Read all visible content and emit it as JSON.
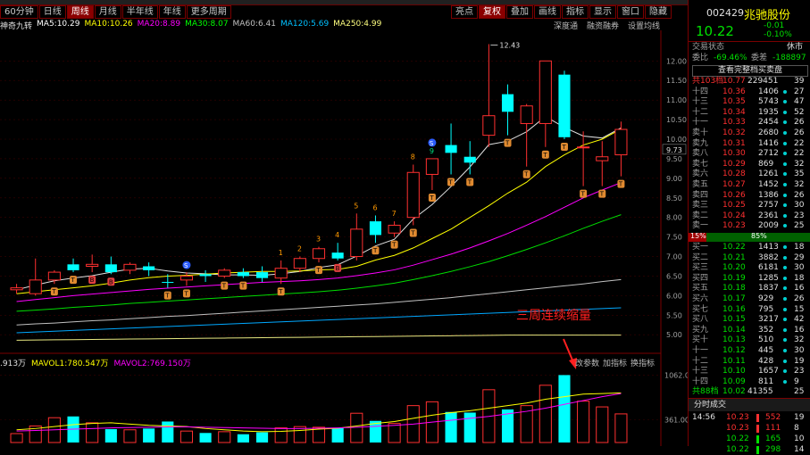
{
  "tabs": [
    {
      "label": "60分钟",
      "active": false
    },
    {
      "label": "日线",
      "active": false
    },
    {
      "label": "周线",
      "active": true
    },
    {
      "label": "月线",
      "active": false
    },
    {
      "label": "半年线",
      "active": false
    },
    {
      "label": "年线",
      "active": false
    },
    {
      "label": "更多周期",
      "active": false
    }
  ],
  "toolbar": [
    {
      "label": "亮点",
      "active": false
    },
    {
      "label": "复权",
      "active": true
    },
    {
      "label": "叠加",
      "active": false
    },
    {
      "label": "画线",
      "active": false
    },
    {
      "label": "指标",
      "active": false
    },
    {
      "label": "显示",
      "active": false
    },
    {
      "label": "窗口",
      "active": false
    },
    {
      "label": "隐藏",
      "active": false
    }
  ],
  "ma_bar": {
    "indicator": "神奇九转",
    "items": [
      {
        "text": "MA5:10.29",
        "color": "#ffffff"
      },
      {
        "text": "MA10:10.26",
        "color": "#ffff00"
      },
      {
        "text": "MA20:8.89",
        "color": "#ff00ff"
      },
      {
        "text": "MA30:8.07",
        "color": "#00ff00"
      },
      {
        "text": "MA60:6.41",
        "color": "#c0c0c0"
      },
      {
        "text": "MA120:5.69",
        "color": "#00c0ff"
      },
      {
        "text": "MA250:4.99",
        "color": "#ffff80"
      }
    ]
  },
  "top_ops": [
    "深度通",
    "融资融券",
    "设置均线"
  ],
  "vol_bar": {
    "items": [
      {
        "text": ".913万",
        "color": "#e0e0e0"
      },
      {
        "text": "MAVOL1:780.547万",
        "color": "#ffff00"
      },
      {
        "text": "MAVOL2:769.150万",
        "color": "#ff00ff"
      }
    ],
    "buttons": [
      "改参数",
      "加指标",
      "换指标"
    ]
  },
  "annotation": "三周连续缩量",
  "chart_data": {
    "type": "candlestick",
    "y_ticks": [
      5.0,
      5.5,
      6.0,
      6.5,
      7.0,
      7.5,
      8.0,
      8.5,
      9.0,
      9.5,
      10.0,
      10.5,
      11.0,
      11.5,
      12.0
    ],
    "ylim": [
      4.8,
      12.6
    ],
    "vol_ticks": [
      "1062.00",
      "361.00"
    ],
    "current_price_label": "9.73",
    "high_label": "12.43",
    "candles": [
      {
        "o": 6.2,
        "h": 6.3,
        "l": 6.05,
        "c": 6.15,
        "up": true,
        "vol": 140
      },
      {
        "o": 6.05,
        "h": 6.95,
        "l": 6.0,
        "c": 6.4,
        "up": true,
        "vol": 260
      },
      {
        "o": 6.4,
        "h": 6.65,
        "l": 6.3,
        "c": 6.6,
        "up": true,
        "vol": 390
      },
      {
        "o": 6.8,
        "h": 6.95,
        "l": 6.6,
        "c": 6.65,
        "up": false,
        "vol": 410
      },
      {
        "o": 6.8,
        "h": 7.05,
        "l": 6.6,
        "c": 6.75,
        "up": true,
        "vol": 310
      },
      {
        "o": 6.8,
        "h": 7.0,
        "l": 6.55,
        "c": 6.6,
        "up": false,
        "vol": 210
      },
      {
        "o": 6.65,
        "h": 6.85,
        "l": 6.55,
        "c": 6.8,
        "up": true,
        "vol": 200
      },
      {
        "o": 6.75,
        "h": 6.85,
        "l": 6.5,
        "c": 6.65,
        "up": false,
        "vol": 220
      },
      {
        "o": 6.35,
        "h": 6.55,
        "l": 6.2,
        "c": 6.35,
        "up": false,
        "vol": 330
      },
      {
        "o": 6.4,
        "h": 6.6,
        "l": 6.25,
        "c": 6.5,
        "up": true,
        "vol": 180
      },
      {
        "o": 6.55,
        "h": 6.65,
        "l": 6.35,
        "c": 6.5,
        "up": false,
        "vol": 150
      },
      {
        "o": 6.5,
        "h": 6.7,
        "l": 6.45,
        "c": 6.65,
        "up": true,
        "vol": 170
      },
      {
        "o": 6.6,
        "h": 6.7,
        "l": 6.45,
        "c": 6.5,
        "up": false,
        "vol": 130
      },
      {
        "o": 6.6,
        "h": 6.75,
        "l": 6.35,
        "c": 6.45,
        "up": false,
        "vol": 160
      },
      {
        "o": 6.45,
        "h": 6.9,
        "l": 6.3,
        "c": 6.7,
        "up": true,
        "vol": 230
      },
      {
        "o": 6.7,
        "h": 7.0,
        "l": 6.6,
        "c": 6.95,
        "up": true,
        "vol": 250
      },
      {
        "o": 6.95,
        "h": 7.25,
        "l": 6.85,
        "c": 7.2,
        "up": true,
        "vol": 240
      },
      {
        "o": 7.1,
        "h": 7.35,
        "l": 6.9,
        "c": 6.95,
        "up": false,
        "vol": 230
      },
      {
        "o": 7.0,
        "h": 8.1,
        "l": 6.9,
        "c": 7.7,
        "up": true,
        "vol": 460
      },
      {
        "o": 7.9,
        "h": 8.05,
        "l": 7.35,
        "c": 7.55,
        "up": false,
        "vol": 340
      },
      {
        "o": 7.6,
        "h": 7.9,
        "l": 7.5,
        "c": 7.8,
        "up": true,
        "vol": 300
      },
      {
        "o": 8.0,
        "h": 9.35,
        "l": 7.8,
        "c": 9.15,
        "up": true,
        "vol": 580
      },
      {
        "o": 9.1,
        "h": 9.5,
        "l": 8.7,
        "c": 9.5,
        "up": true,
        "vol": 640
      },
      {
        "o": 9.85,
        "h": 10.4,
        "l": 9.1,
        "c": 9.65,
        "up": false,
        "vol": 480
      },
      {
        "o": 9.55,
        "h": 9.95,
        "l": 9.1,
        "c": 9.4,
        "up": false,
        "vol": 470
      },
      {
        "o": 10.1,
        "h": 12.43,
        "l": 9.8,
        "c": 10.6,
        "up": true,
        "vol": 830
      },
      {
        "o": 11.15,
        "h": 11.4,
        "l": 10.1,
        "c": 10.7,
        "up": false,
        "vol": 520
      },
      {
        "o": 10.4,
        "h": 10.9,
        "l": 9.3,
        "c": 10.85,
        "up": true,
        "vol": 580
      },
      {
        "o": 10.4,
        "h": 12.0,
        "l": 9.8,
        "c": 12.0,
        "up": true,
        "vol": 900
      },
      {
        "o": 11.65,
        "h": 11.75,
        "l": 10.0,
        "c": 10.05,
        "up": false,
        "vol": 1060
      },
      {
        "o": 9.8,
        "h": 10.2,
        "l": 8.8,
        "c": 9.8,
        "up": true,
        "vol": 650
      },
      {
        "o": 9.55,
        "h": 9.95,
        "l": 8.8,
        "c": 9.45,
        "up": true,
        "vol": 560
      },
      {
        "o": 9.6,
        "h": 10.45,
        "l": 9.05,
        "c": 10.25,
        "up": true,
        "vol": 450
      }
    ],
    "ma": [
      {
        "name": "MA5",
        "color": "#e0e0e0",
        "values": [
          6.15,
          6.27,
          6.38,
          6.45,
          6.51,
          6.6,
          6.68,
          6.7,
          6.63,
          6.58,
          6.56,
          6.53,
          6.53,
          6.52,
          6.56,
          6.62,
          6.72,
          6.79,
          7.01,
          7.27,
          7.44,
          7.96,
          8.33,
          8.79,
          9.29,
          9.86,
          9.95,
          10.19,
          10.58,
          10.3,
          10.08,
          10.03,
          10.29
        ]
      },
      {
        "name": "MA10",
        "color": "#ffff00",
        "values": [
          6.05,
          6.1,
          6.15,
          6.2,
          6.25,
          6.32,
          6.4,
          6.46,
          6.5,
          6.52,
          6.55,
          6.58,
          6.6,
          6.62,
          6.62,
          6.63,
          6.66,
          6.67,
          6.75,
          6.91,
          7.03,
          7.22,
          7.46,
          7.7,
          8.0,
          8.3,
          8.62,
          8.9,
          9.3,
          9.6,
          9.85,
          10.0,
          10.26
        ]
      },
      {
        "name": "MA20",
        "color": "#ff00ff",
        "values": [
          5.85,
          5.9,
          5.95,
          6.0,
          6.04,
          6.08,
          6.12,
          6.16,
          6.19,
          6.22,
          6.25,
          6.28,
          6.31,
          6.34,
          6.36,
          6.38,
          6.41,
          6.45,
          6.51,
          6.58,
          6.66,
          6.78,
          6.92,
          7.06,
          7.22,
          7.4,
          7.59,
          7.8,
          8.02,
          8.26,
          8.5,
          8.7,
          8.89
        ]
      },
      {
        "name": "MA30",
        "color": "#00dd00",
        "values": [
          5.6,
          5.63,
          5.66,
          5.7,
          5.73,
          5.76,
          5.8,
          5.83,
          5.86,
          5.89,
          5.92,
          5.95,
          5.98,
          6.01,
          6.04,
          6.07,
          6.1,
          6.14,
          6.19,
          6.25,
          6.32,
          6.41,
          6.51,
          6.62,
          6.74,
          6.87,
          7.02,
          7.18,
          7.35,
          7.53,
          7.72,
          7.9,
          8.07
        ]
      },
      {
        "name": "MA60",
        "color": "#c0c0c0",
        "values": [
          5.25,
          5.28,
          5.3,
          5.33,
          5.36,
          5.38,
          5.41,
          5.44,
          5.47,
          5.49,
          5.52,
          5.55,
          5.58,
          5.61,
          5.64,
          5.67,
          5.7,
          5.73,
          5.76,
          5.79,
          5.83,
          5.87,
          5.91,
          5.95,
          6.0,
          6.05,
          6.1,
          6.15,
          6.2,
          6.25,
          6.3,
          6.36,
          6.41
        ]
      },
      {
        "name": "MA120",
        "color": "#00a8ff",
        "values": [
          5.05,
          5.07,
          5.09,
          5.11,
          5.13,
          5.15,
          5.17,
          5.19,
          5.21,
          5.23,
          5.25,
          5.27,
          5.29,
          5.31,
          5.33,
          5.35,
          5.37,
          5.39,
          5.41,
          5.43,
          5.45,
          5.47,
          5.49,
          5.51,
          5.53,
          5.55,
          5.57,
          5.59,
          5.61,
          5.63,
          5.65,
          5.67,
          5.69
        ]
      },
      {
        "name": "MA250",
        "color": "#e8e880",
        "values": [
          4.86,
          4.865,
          4.87,
          4.875,
          4.88,
          4.885,
          4.89,
          4.895,
          4.9,
          4.905,
          4.91,
          4.915,
          4.92,
          4.925,
          4.93,
          4.935,
          4.94,
          4.945,
          4.95,
          4.955,
          4.96,
          4.965,
          4.97,
          4.975,
          4.98,
          4.985,
          4.99,
          4.99,
          4.99,
          4.99,
          4.99,
          4.99,
          4.99
        ]
      }
    ],
    "mavol1": [
      200,
      220,
      250,
      280,
      300,
      310,
      290,
      270,
      260,
      250,
      220,
      200,
      180,
      170,
      175,
      190,
      210,
      225,
      260,
      300,
      330,
      380,
      430,
      470,
      500,
      540,
      580,
      620,
      680,
      720,
      760,
      770,
      780
    ],
    "mavol2": [
      180,
      190,
      200,
      210,
      220,
      230,
      235,
      240,
      245,
      245,
      240,
      235,
      230,
      225,
      220,
      220,
      225,
      230,
      240,
      255,
      270,
      290,
      320,
      350,
      380,
      410,
      450,
      490,
      540,
      600,
      660,
      720,
      769
    ],
    "nine_turn_labels": [
      {
        "i": 14,
        "text": "1",
        "color": "#ff9900",
        "pos": "above"
      },
      {
        "i": 15,
        "text": "2",
        "color": "#ff9900",
        "pos": "above"
      },
      {
        "i": 16,
        "text": "3",
        "color": "#ff9900",
        "pos": "above"
      },
      {
        "i": 17,
        "text": "4",
        "color": "#ff9900",
        "pos": "above"
      },
      {
        "i": 18,
        "text": "5",
        "color": "#ff9900",
        "pos": "above"
      },
      {
        "i": 19,
        "text": "6",
        "color": "#ff9900",
        "pos": "above"
      },
      {
        "i": 20,
        "text": "7",
        "color": "#ff9900",
        "pos": "above"
      },
      {
        "i": 21,
        "text": "8",
        "color": "#ff9900",
        "pos": "above"
      },
      {
        "i": 22,
        "text": "9",
        "color": "#00e080",
        "pos": "above"
      }
    ],
    "badges": [
      {
        "i": 2,
        "text": "T",
        "kind": "T"
      },
      {
        "i": 3,
        "text": "T",
        "kind": "T"
      },
      {
        "i": 4,
        "text": "B",
        "kind": "B"
      },
      {
        "i": 5,
        "text": "B",
        "kind": "B"
      },
      {
        "i": 8,
        "text": "T",
        "kind": "T"
      },
      {
        "i": 9,
        "text": "T",
        "kind": "T"
      },
      {
        "i": 11,
        "text": "T",
        "kind": "T"
      },
      {
        "i": 12,
        "text": "T",
        "kind": "T"
      },
      {
        "i": 14,
        "text": "T",
        "kind": "T"
      },
      {
        "i": 16,
        "text": "T",
        "kind": "T"
      },
      {
        "i": 17,
        "text": "B",
        "kind": "B"
      },
      {
        "i": 19,
        "text": "T",
        "kind": "T"
      },
      {
        "i": 20,
        "text": "T",
        "kind": "T"
      },
      {
        "i": 21,
        "text": "T",
        "kind": "T"
      },
      {
        "i": 22,
        "text": "T",
        "kind": "T"
      },
      {
        "i": 23,
        "text": "T",
        "kind": "T"
      },
      {
        "i": 24,
        "text": "T",
        "kind": "T"
      },
      {
        "i": 26,
        "text": "T",
        "kind": "T"
      },
      {
        "i": 27,
        "text": "T",
        "kind": "T"
      },
      {
        "i": 28,
        "text": "T",
        "kind": "T"
      },
      {
        "i": 29,
        "text": "T",
        "kind": "T"
      },
      {
        "i": 30,
        "text": "T",
        "kind": "T"
      },
      {
        "i": 31,
        "text": "T",
        "kind": "T"
      },
      {
        "i": 32,
        "text": "T",
        "kind": "T"
      }
    ],
    "s_markers": [
      {
        "i": 9
      },
      {
        "i": 22
      }
    ]
  },
  "right": {
    "code": "002429",
    "name": "兆驰股份",
    "price": "10.22",
    "change": "-0.01",
    "pct": "-0.10%",
    "status_label": "交易状态",
    "status_value": "休市",
    "webi_label": "委比",
    "webi_value": "-69.46%",
    "weicha_label": "委差",
    "weicha_value": "-188897",
    "full_link": "查看完整档买卖盘",
    "sell_total": {
      "label": "共103档",
      "price": "10.77",
      "vol": "229451",
      "n": "39"
    },
    "sells": [
      {
        "l": "十四",
        "p": "10.36",
        "v": "1406",
        "n": "27"
      },
      {
        "l": "十三",
        "p": "10.35",
        "v": "5743",
        "n": "47"
      },
      {
        "l": "十二",
        "p": "10.34",
        "v": "1935",
        "n": "52"
      },
      {
        "l": "十一",
        "p": "10.33",
        "v": "2454",
        "n": "26"
      },
      {
        "l": "卖十",
        "p": "10.32",
        "v": "2680",
        "n": "26"
      },
      {
        "l": "卖九",
        "p": "10.31",
        "v": "1416",
        "n": "22"
      },
      {
        "l": "卖八",
        "p": "10.30",
        "v": "2712",
        "n": "22"
      },
      {
        "l": "卖七",
        "p": "10.29",
        "v": "869",
        "n": "32"
      },
      {
        "l": "卖六",
        "p": "10.28",
        "v": "1261",
        "n": "35"
      },
      {
        "l": "卖五",
        "p": "10.27",
        "v": "1452",
        "n": "32"
      },
      {
        "l": "卖四",
        "p": "10.26",
        "v": "1386",
        "n": "26"
      },
      {
        "l": "卖三",
        "p": "10.25",
        "v": "2757",
        "n": "30"
      },
      {
        "l": "卖二",
        "p": "10.24",
        "v": "2361",
        "n": "23"
      },
      {
        "l": "卖一",
        "p": "10.23",
        "v": "2009",
        "n": "25"
      }
    ],
    "ratio_left": "15%",
    "ratio_right": "85%",
    "buys": [
      {
        "l": "买一",
        "p": "10.22",
        "v": "1413",
        "n": "18"
      },
      {
        "l": "买二",
        "p": "10.21",
        "v": "3882",
        "n": "29"
      },
      {
        "l": "买三",
        "p": "10.20",
        "v": "6181",
        "n": "30"
      },
      {
        "l": "买四",
        "p": "10.19",
        "v": "1285",
        "n": "18"
      },
      {
        "l": "买五",
        "p": "10.18",
        "v": "1837",
        "n": "16"
      },
      {
        "l": "买六",
        "p": "10.17",
        "v": "929",
        "n": "26"
      },
      {
        "l": "买七",
        "p": "10.16",
        "v": "795",
        "n": "15"
      },
      {
        "l": "买八",
        "p": "10.15",
        "v": "3217",
        "n": "42"
      },
      {
        "l": "买九",
        "p": "10.14",
        "v": "352",
        "n": "16"
      },
      {
        "l": "买十",
        "p": "10.13",
        "v": "510",
        "n": "32"
      },
      {
        "l": "十一",
        "p": "10.12",
        "v": "445",
        "n": "30"
      },
      {
        "l": "十二",
        "p": "10.11",
        "v": "428",
        "n": "19"
      },
      {
        "l": "十三",
        "p": "10.10",
        "v": "1657",
        "n": "23"
      },
      {
        "l": "十四",
        "p": "10.09",
        "v": "811",
        "n": "9"
      }
    ],
    "buy_total": {
      "label": "共88档",
      "price": "10.02",
      "vol": "41355",
      "n": "25"
    },
    "trades_title": "分时成交",
    "trades": [
      {
        "t": "14:56",
        "p": "10.23",
        "v": "552",
        "n": "19"
      },
      {
        "t": "",
        "p": "10.23",
        "v": "111",
        "n": "8"
      },
      {
        "t": "",
        "p": "10.22",
        "v": "165",
        "n": "10"
      },
      {
        "t": "",
        "p": "10.22",
        "v": "298",
        "n": "14"
      }
    ]
  }
}
